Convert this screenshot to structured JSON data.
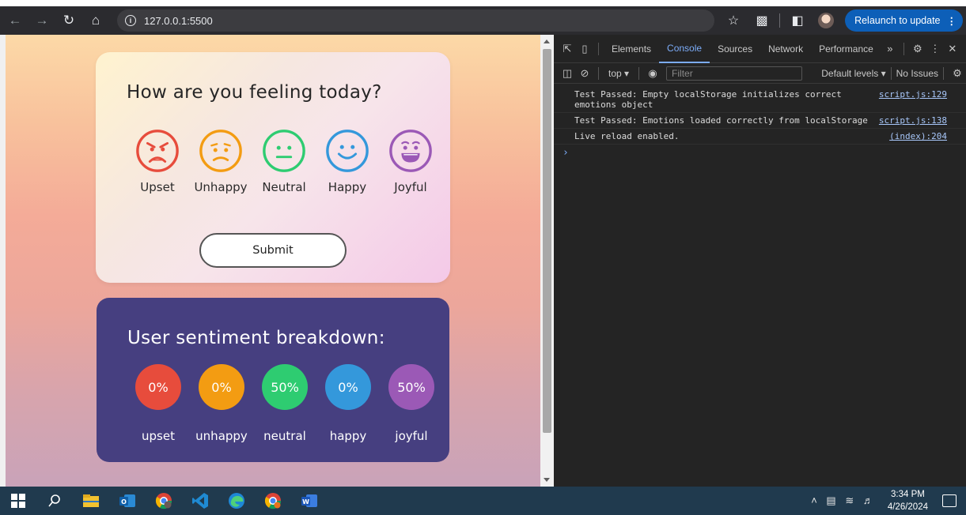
{
  "browser": {
    "url": "127.0.0.1:5500",
    "relaunch_label": "Relaunch to update"
  },
  "mood_card": {
    "title": "How are you feeling today?",
    "options": [
      {
        "label": "Upset",
        "color": "#e74c3c",
        "icon": "angry-face-icon"
      },
      {
        "label": "Unhappy",
        "color": "#f39c12",
        "icon": "sad-face-icon"
      },
      {
        "label": "Neutral",
        "color": "#2ecc71",
        "icon": "neutral-face-icon"
      },
      {
        "label": "Happy",
        "color": "#3498db",
        "icon": "smile-face-icon"
      },
      {
        "label": "Joyful",
        "color": "#9b59b6",
        "icon": "grin-face-icon"
      }
    ],
    "submit_label": "Submit"
  },
  "sentiment_card": {
    "title": "User sentiment breakdown:",
    "stats": [
      {
        "label": "upset",
        "value": "0%",
        "color": "#e74c3c"
      },
      {
        "label": "unhappy",
        "value": "0%",
        "color": "#f39c12"
      },
      {
        "label": "neutral",
        "value": "50%",
        "color": "#2ecc71"
      },
      {
        "label": "happy",
        "value": "0%",
        "color": "#3498db"
      },
      {
        "label": "joyful",
        "value": "50%",
        "color": "#9b59b6"
      }
    ]
  },
  "devtools": {
    "tabs": [
      "Elements",
      "Console",
      "Sources",
      "Network",
      "Performance"
    ],
    "active_tab": "Console",
    "context": "top",
    "filter_placeholder": "Filter",
    "levels": "Default levels",
    "issues": "No Issues",
    "logs": [
      {
        "message": "Test Passed: Empty localStorage initializes correct emotions object",
        "source": "script.js:129"
      },
      {
        "message": "Test Passed: Emotions loaded correctly from localStorage",
        "source": "script.js:138"
      },
      {
        "message": "Live reload enabled.",
        "source": "(index):204"
      }
    ]
  },
  "taskbar": {
    "time": "3:34 PM",
    "date": "4/26/2024"
  }
}
